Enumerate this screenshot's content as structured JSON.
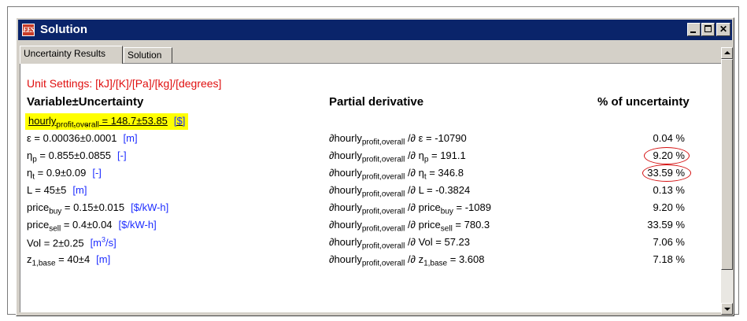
{
  "window": {
    "title": "Solution",
    "app_icon": "EES",
    "buttons": {
      "minimize": "_",
      "maximize": "□",
      "close": "✕"
    }
  },
  "tabs": [
    {
      "label": "Uncertainty Results",
      "active": true
    },
    {
      "label": "Solution",
      "active": false
    }
  ],
  "unit_settings": "Unit Settings: [kJ]/[K]/[Pa]/[kg]/[degrees]",
  "headers": {
    "variable": "Variable±Uncertainty",
    "partial": "Partial derivative",
    "percent": "% of uncertainty"
  },
  "objective": {
    "name": "hourly",
    "sub": "profit,overall",
    "value": " = 148.7±53.85",
    "unit": "[$]"
  },
  "rows": [
    {
      "var": "ε",
      "var_sub": "",
      "value": " = 0.00036±0.0001",
      "unit": "[m]",
      "pd_var": "ε",
      "pd_sub": "",
      "pd_value": " = -10790",
      "pct": "0.04 %",
      "circled": false
    },
    {
      "var": "η",
      "var_sub": "p",
      "value": " = 0.855±0.0855",
      "unit": "[-]",
      "pd_var": "η",
      "pd_sub": "p",
      "pd_value": " = 191.1",
      "pct": "9.20 %",
      "circled": true
    },
    {
      "var": "η",
      "var_sub": "t",
      "value": " = 0.9±0.09",
      "unit": "[-]",
      "pd_var": "η",
      "pd_sub": "t",
      "pd_value": " = 346.8",
      "pct": "33.59 %",
      "circled": true
    },
    {
      "var": "L",
      "var_sub": "",
      "value": " = 45±5",
      "unit": "[m]",
      "pd_var": "L",
      "pd_sub": "",
      "pd_value": " = -0.3824",
      "pct": "0.13 %",
      "circled": false
    },
    {
      "var": "price",
      "var_sub": "buy",
      "value": " = 0.15±0.015",
      "unit": "[$/kW-h]",
      "pd_var": "price",
      "pd_sub": "buy",
      "pd_value": " = -1089",
      "pct": "9.20 %",
      "circled": false
    },
    {
      "var": "price",
      "var_sub": "sell",
      "value": " = 0.4±0.04",
      "unit": "[$/kW-h]",
      "pd_var": "price",
      "pd_sub": "sell",
      "pd_value": " = 780.3",
      "pct": "33.59 %",
      "circled": false
    },
    {
      "var": "Vol",
      "var_sub": "",
      "value": " = 2±0.25",
      "unit": "[m3/s]",
      "pd_var": "Vol",
      "pd_sub": "",
      "pd_value": " = 57.23",
      "pct": "7.06 %",
      "circled": false
    },
    {
      "var": "z",
      "var_sub": "1,base",
      "value": " = 40±4",
      "unit": "[m]",
      "pd_var": "z",
      "pd_sub": "1,base",
      "pd_value": " = 3.608",
      "pct": "7.18 %",
      "circled": false
    }
  ],
  "partial_prefix": {
    "symbol": "∂",
    "name": "hourly",
    "sub": "profit,overall",
    "sep": " /∂ "
  },
  "colors": {
    "titlebar": "#0a246a",
    "unit_settings": "#e01010",
    "units": "#1e2dff",
    "highlight": "#ffff00",
    "circle": "#d41010"
  }
}
